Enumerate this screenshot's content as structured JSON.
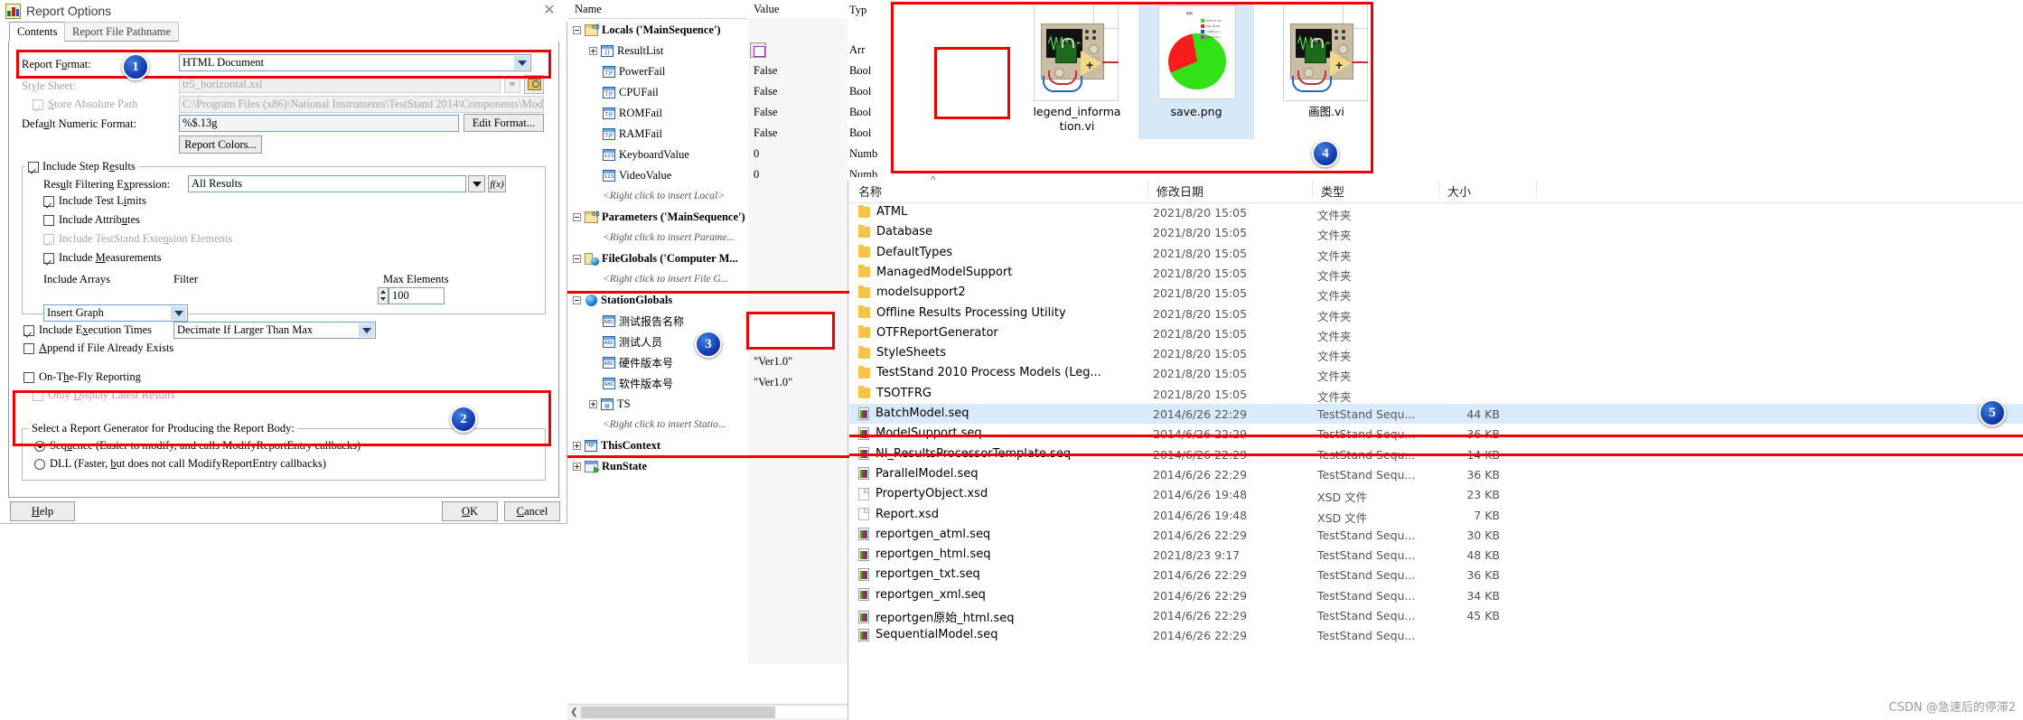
{
  "dialog": {
    "title": "Report Options",
    "close_icon": "close-icon",
    "tabs": [
      {
        "label": "Contents",
        "selected": true
      },
      {
        "label": "Report File Pathname",
        "selected": false
      }
    ],
    "fields": {
      "report_format_label": "Report Format:",
      "report_format_value": "HTML Document",
      "style_sheet_label": "Style Sheet:",
      "style_sheet_value": "tr5_horizontal.xsl",
      "store_absolute_path_label": "Store Absolute Path",
      "store_absolute_path_value": "C:\\Program Files (x86)\\National Instruments\\TestStand 2014\\Components\\Mode",
      "default_numeric_format_label": "Default Numeric Format:",
      "default_numeric_format_value": "%$.13g",
      "report_colors_button": "Report Colors...",
      "edit_format_button": "Edit Format..."
    },
    "include_step_results": {
      "label": "Include Step Results",
      "checked": true,
      "result_filtering_label": "Result Filtering Expression:",
      "result_filtering_value": "All Results",
      "checkboxes": [
        {
          "label": "Include Test Limits",
          "checked": true,
          "disabled": false
        },
        {
          "label": "Include Attributes",
          "checked": false,
          "disabled": false
        },
        {
          "label": "Include TestStand Extension Elements",
          "checked": true,
          "disabled": true
        },
        {
          "label": "Include Measurements",
          "checked": true,
          "disabled": false
        }
      ],
      "include_arrays_label": "Include Arrays",
      "include_arrays_value": "Insert Graph",
      "filter_label": "Filter",
      "filter_value": "Decimate If Larger Than Max",
      "max_elements_label": "Max Elements",
      "max_elements_value": "100"
    },
    "bottom_checkboxes": [
      {
        "label": "Include Execution Times",
        "checked": true,
        "disabled": false
      },
      {
        "label": "Append if File Already Exists",
        "checked": false,
        "disabled": false
      },
      {
        "label": "On-The-Fly Reporting",
        "checked": false,
        "disabled": false
      },
      {
        "label": "Only Display Latest Results",
        "checked": false,
        "disabled": true
      }
    ],
    "generator_group": {
      "legend": "Select a Report Generator for Producing the Report Body:",
      "options": [
        {
          "label": "Sequence (Easier to modify, and calls ModifyReportEntry callbacks)",
          "selected": true
        },
        {
          "label": "DLL (Faster, but does not call ModifyReportEntry callbacks)",
          "selected": false
        }
      ]
    },
    "buttons": {
      "help": "Help",
      "ok": "OK",
      "cancel": "Cancel"
    }
  },
  "variables_pane": {
    "columns": {
      "name": "Name",
      "value": "Value",
      "type": "Typ"
    },
    "rows": [
      {
        "indent": 0,
        "expander": "minus",
        "icon": "locals-icon",
        "label": "Locals ('MainSequence')",
        "bold": true,
        "value": "",
        "type": ""
      },
      {
        "indent": 1,
        "expander": "plus",
        "icon": "array-icon",
        "label": "ResultList",
        "bold": false,
        "value": "",
        "type": "Arr",
        "has_value_icon": true
      },
      {
        "indent": 1,
        "expander": "none",
        "icon": "boolean-icon",
        "label": "PowerFail",
        "bold": false,
        "value": "False",
        "type": "Bool"
      },
      {
        "indent": 1,
        "expander": "none",
        "icon": "boolean-icon",
        "label": "CPUFail",
        "bold": false,
        "value": "False",
        "type": "Bool"
      },
      {
        "indent": 1,
        "expander": "none",
        "icon": "boolean-icon",
        "label": "ROMFail",
        "bold": false,
        "value": "False",
        "type": "Bool"
      },
      {
        "indent": 1,
        "expander": "none",
        "icon": "boolean-icon",
        "label": "RAMFail",
        "bold": false,
        "value": "False",
        "type": "Bool"
      },
      {
        "indent": 1,
        "expander": "none",
        "icon": "number-icon",
        "label": "KeyboardValue",
        "bold": false,
        "value": "0",
        "type": "Numb"
      },
      {
        "indent": 1,
        "expander": "none",
        "icon": "number-icon",
        "label": "VideoValue",
        "bold": false,
        "value": "0",
        "type": "Numb"
      },
      {
        "indent": 1,
        "expander": "none",
        "icon": "none",
        "label": "<Right click to insert Local>",
        "italic": true,
        "value": "",
        "type": ""
      },
      {
        "indent": 0,
        "expander": "minus",
        "icon": "parameters-icon",
        "label": "Parameters ('MainSequence')",
        "bold": true,
        "value": "",
        "type": ""
      },
      {
        "indent": 1,
        "expander": "none",
        "icon": "none",
        "label": "<Right click to insert Parame...",
        "italic": true,
        "value": "",
        "type": ""
      },
      {
        "indent": 0,
        "expander": "minus",
        "icon": "fileglobals-icon",
        "label": "FileGlobals ('Computer M...",
        "bold": true,
        "value": "",
        "type": ""
      },
      {
        "indent": 1,
        "expander": "none",
        "icon": "none",
        "label": "<Right click to insert File G...",
        "italic": true,
        "value": "",
        "type": ""
      },
      {
        "indent": 0,
        "expander": "minus",
        "icon": "globe-icon",
        "label": "StationGlobals",
        "bold": true,
        "value": "",
        "type": ""
      },
      {
        "indent": 1,
        "expander": "none",
        "icon": "string-icon",
        "label": "测试报告名称",
        "chinese": true,
        "value": "",
        "type": ""
      },
      {
        "indent": 1,
        "expander": "none",
        "icon": "string-icon",
        "label": "测试人员",
        "chinese": true,
        "value": "",
        "type": ""
      },
      {
        "indent": 1,
        "expander": "none",
        "icon": "string-icon",
        "label": "硬件版本号",
        "chinese": true,
        "value": "\"Ver1.0\"",
        "type": ""
      },
      {
        "indent": 1,
        "expander": "none",
        "icon": "string-icon",
        "label": "软件版本号",
        "chinese": true,
        "value": "\"Ver1.0\"",
        "type": ""
      },
      {
        "indent": 1,
        "expander": "plus",
        "icon": "container-icon",
        "label": "TS",
        "bold": false,
        "value": "",
        "type": ""
      },
      {
        "indent": 1,
        "expander": "none",
        "icon": "none",
        "label": "<Right click to insert Statio...",
        "italic": true,
        "value": "",
        "type": ""
      },
      {
        "indent": 0,
        "expander": "plus",
        "icon": "thiscontext-icon",
        "label": "ThisContext",
        "bold": true,
        "value": "",
        "type": ""
      },
      {
        "indent": 0,
        "expander": "plus",
        "icon": "runstate-icon",
        "label": "RunState",
        "bold": true,
        "value": "",
        "type": ""
      }
    ]
  },
  "thumbnails": {
    "items": [
      {
        "name": "legend_informa\ntion.vi",
        "icon": "labview-vi-icon",
        "selected": false
      },
      {
        "name": "save.png",
        "icon": "png-image-icon",
        "selected": true
      },
      {
        "name": "画图.vi",
        "icon": "labview-vi-icon",
        "selected": false
      }
    ],
    "pie_legend": [
      "PASS  71.4%",
      "FAIL   28.6%",
      "CANFlow  2",
      "RS485ext  1"
    ]
  },
  "file_explorer": {
    "columns": [
      "名称",
      "修改日期",
      "类型",
      "大小"
    ],
    "rows": [
      {
        "name": "ATML",
        "date": "2021/8/20 15:05",
        "type": "文件夹",
        "size": "",
        "icon": "folder-icon",
        "selected": false
      },
      {
        "name": "Database",
        "date": "2021/8/20 15:05",
        "type": "文件夹",
        "size": "",
        "icon": "folder-icon",
        "selected": false
      },
      {
        "name": "DefaultTypes",
        "date": "2021/8/20 15:05",
        "type": "文件夹",
        "size": "",
        "icon": "folder-icon",
        "selected": false
      },
      {
        "name": "ManagedModelSupport",
        "date": "2021/8/20 15:05",
        "type": "文件夹",
        "size": "",
        "icon": "folder-icon",
        "selected": false
      },
      {
        "name": "modelsupport2",
        "date": "2021/8/20 15:05",
        "type": "文件夹",
        "size": "",
        "icon": "folder-icon",
        "selected": false
      },
      {
        "name": "Offline Results Processing Utility",
        "date": "2021/8/20 15:05",
        "type": "文件夹",
        "size": "",
        "icon": "folder-icon",
        "selected": false
      },
      {
        "name": "OTFReportGenerator",
        "date": "2021/8/20 15:05",
        "type": "文件夹",
        "size": "",
        "icon": "folder-icon",
        "selected": false
      },
      {
        "name": "StyleSheets",
        "date": "2021/8/20 15:05",
        "type": "文件夹",
        "size": "",
        "icon": "folder-icon",
        "selected": false
      },
      {
        "name": "TestStand 2010 Process Models (Leg...",
        "date": "2021/8/20 15:05",
        "type": "文件夹",
        "size": "",
        "icon": "folder-icon",
        "selected": false
      },
      {
        "name": "TSOTFRG",
        "date": "2021/8/20 15:05",
        "type": "文件夹",
        "size": "",
        "icon": "folder-icon",
        "selected": false
      },
      {
        "name": "BatchModel.seq",
        "date": "2014/6/26 22:29",
        "type": "TestStand Sequ...",
        "size": "44 KB",
        "icon": "seq-file-icon",
        "selected": true
      },
      {
        "name": "ModelSupport.seq",
        "date": "2014/6/26 22:29",
        "type": "TestStand Sequ...",
        "size": "36 KB",
        "icon": "seq-file-icon",
        "selected": false
      },
      {
        "name": "NI_ResultsProcessorTemplate.seq",
        "date": "2014/6/26 22:29",
        "type": "TestStand Sequ...",
        "size": "14 KB",
        "icon": "seq-file-icon",
        "selected": false
      },
      {
        "name": "ParallelModel.seq",
        "date": "2014/6/26 22:29",
        "type": "TestStand Sequ...",
        "size": "36 KB",
        "icon": "seq-file-icon",
        "selected": false
      },
      {
        "name": "PropertyObject.xsd",
        "date": "2014/6/26 19:48",
        "type": "XSD 文件",
        "size": "23 KB",
        "icon": "xsd-file-icon",
        "selected": false
      },
      {
        "name": "Report.xsd",
        "date": "2014/6/26 19:48",
        "type": "XSD 文件",
        "size": "7 KB",
        "icon": "xsd-file-icon",
        "selected": false
      },
      {
        "name": "reportgen_atml.seq",
        "date": "2014/6/26 22:29",
        "type": "TestStand Sequ...",
        "size": "30 KB",
        "icon": "seq-file-icon",
        "selected": false
      },
      {
        "name": "reportgen_html.seq",
        "date": "2021/8/23 9:17",
        "type": "TestStand Sequ...",
        "size": "48 KB",
        "icon": "seq-file-icon",
        "selected": false,
        "highlighted": true
      },
      {
        "name": "reportgen_txt.seq",
        "date": "2014/6/26 22:29",
        "type": "TestStand Sequ...",
        "size": "36 KB",
        "icon": "seq-file-icon",
        "selected": false
      },
      {
        "name": "reportgen_xml.seq",
        "date": "2014/6/26 22:29",
        "type": "TestStand Sequ...",
        "size": "34 KB",
        "icon": "seq-file-icon",
        "selected": false
      },
      {
        "name": "reportgen原始_html.seq",
        "date": "2014/6/26 22:29",
        "type": "TestStand Sequ...",
        "size": "45 KB",
        "icon": "seq-file-icon",
        "selected": false
      },
      {
        "name": "SequentialModel.seq",
        "date": "2014/6/26 22:29",
        "type": "TestStand Sequ...",
        "size": "",
        "icon": "seq-file-icon",
        "selected": false
      }
    ],
    "watermark": "CSDN @急速后的停滞2"
  },
  "annotations": {
    "badges": [
      "1",
      "2",
      "3",
      "4",
      "5"
    ],
    "color": "#ee0000"
  },
  "type_column_fragment": [
    "Typ",
    "Arr",
    "Bool",
    "Bool",
    "Bool",
    "Bool",
    "Numb",
    "Numb"
  ]
}
